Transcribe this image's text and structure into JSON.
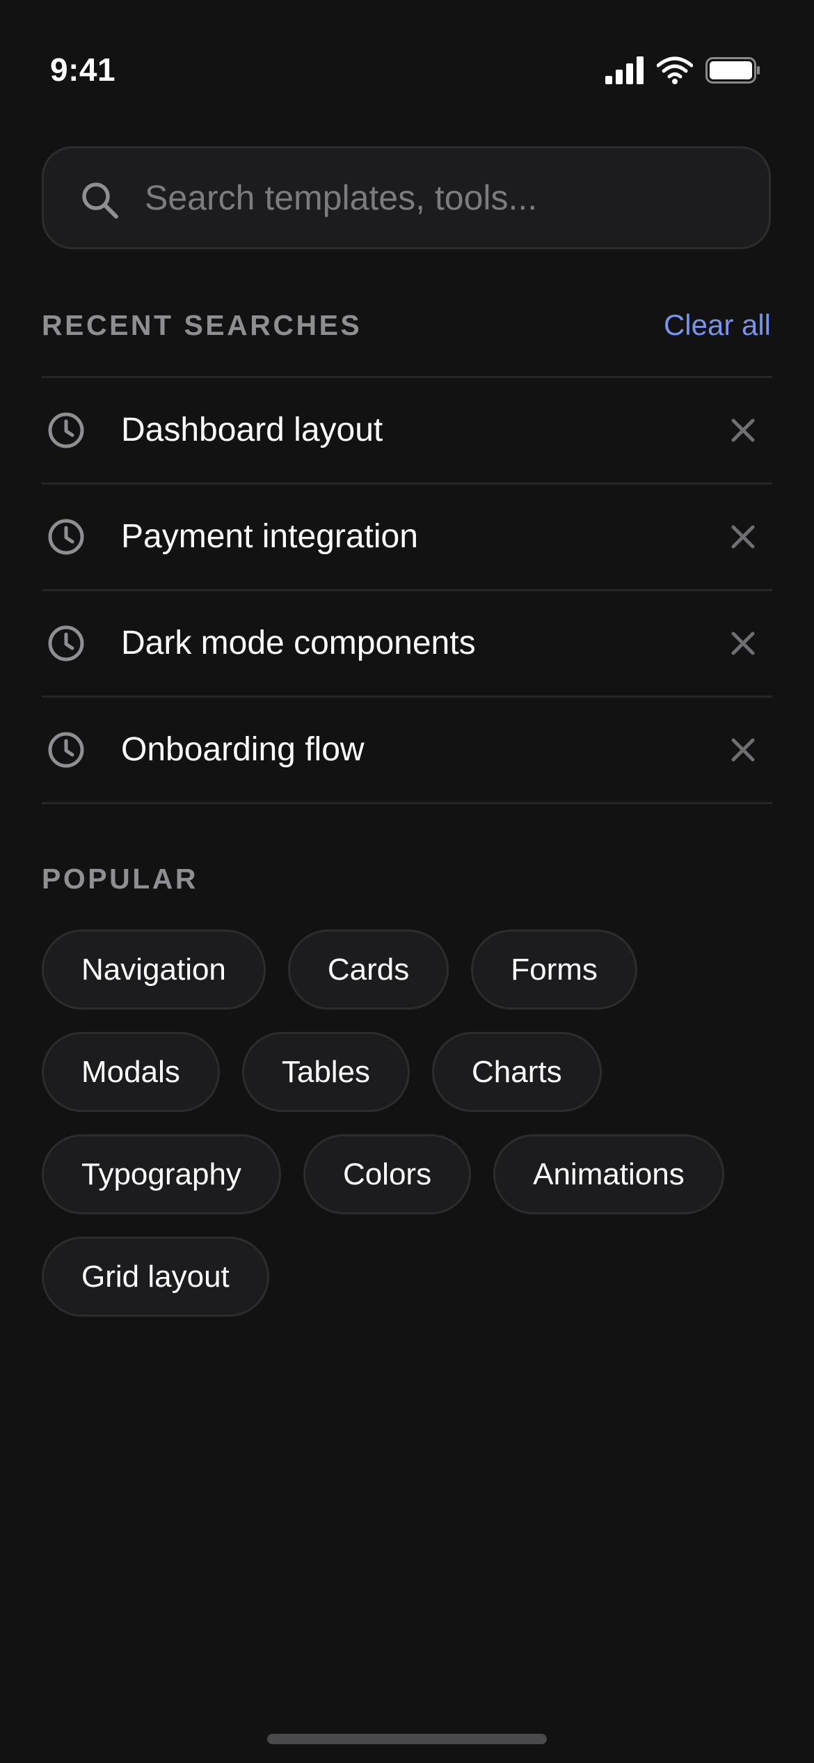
{
  "status_bar": {
    "time": "9:41",
    "icons": [
      "cellular-signal-icon",
      "wifi-icon",
      "battery-icon"
    ]
  },
  "search": {
    "placeholder": "Search templates, tools...",
    "value": "",
    "icon": "search-icon"
  },
  "recent": {
    "title": "RECENT SEARCHES",
    "clear_label": "Clear all",
    "items": [
      {
        "label": "Dashboard layout"
      },
      {
        "label": "Payment integration"
      },
      {
        "label": "Dark mode components"
      },
      {
        "label": "Onboarding flow"
      }
    ]
  },
  "popular": {
    "title": "POPULAR",
    "tags": [
      "Navigation",
      "Cards",
      "Forms",
      "Modals",
      "Tables",
      "Charts",
      "Typography",
      "Colors",
      "Animations",
      "Grid layout"
    ]
  },
  "colors": {
    "background": "#121212",
    "surface": "#1c1c1e",
    "border": "#2c2c2e",
    "accent": "#7b93ec",
    "muted_text": "#8e8e93",
    "text": "#ffffff"
  }
}
